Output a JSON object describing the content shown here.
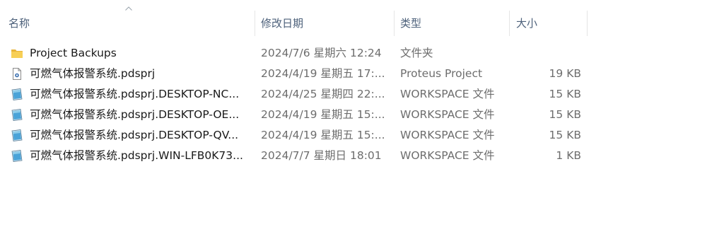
{
  "columns": {
    "name": "名称",
    "date": "修改日期",
    "type": "类型",
    "size": "大小"
  },
  "rows": [
    {
      "icon": "folder-icon",
      "name": "Project Backups",
      "date": "2024/7/6 星期六 12:24",
      "type": "文件夹",
      "size": ""
    },
    {
      "icon": "proteus-file-icon",
      "name": "可燃气体报警系统.pdsprj",
      "date": "2024/4/19 星期五 17:...",
      "type": "Proteus Project",
      "size": "19 KB"
    },
    {
      "icon": "workspace-file-icon",
      "name": "可燃气体报警系统.pdsprj.DESKTOP-NC...",
      "date": "2024/4/25 星期四 22:...",
      "type": "WORKSPACE 文件",
      "size": "15 KB"
    },
    {
      "icon": "workspace-file-icon",
      "name": "可燃气体报警系统.pdsprj.DESKTOP-OE...",
      "date": "2024/4/19 星期五 15:...",
      "type": "WORKSPACE 文件",
      "size": "15 KB"
    },
    {
      "icon": "workspace-file-icon",
      "name": "可燃气体报警系统.pdsprj.DESKTOP-QV...",
      "date": "2024/4/19 星期五 15:...",
      "type": "WORKSPACE 文件",
      "size": "15 KB"
    },
    {
      "icon": "workspace-file-icon",
      "name": "可燃气体报警系统.pdsprj.WIN-LFB0K73...",
      "date": "2024/7/7 星期日 18:01",
      "type": "WORKSPACE 文件",
      "size": "1 KB"
    }
  ]
}
